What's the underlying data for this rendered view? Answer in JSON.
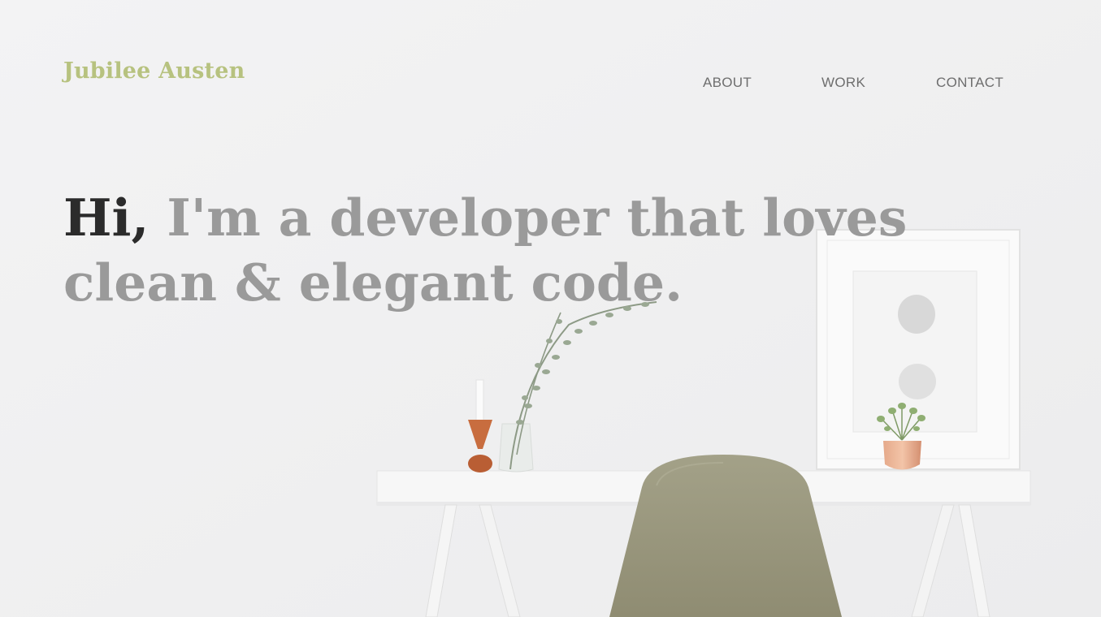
{
  "header": {
    "brand": "Jubilee Austen",
    "nav": {
      "about": "ABOUT",
      "work": "WORK",
      "contact": "CONTACT"
    }
  },
  "hero": {
    "greeting": "Hi,",
    "line1_rest": " I'm a developer that loves",
    "line2": "clean & elegant code."
  },
  "colors": {
    "brand": "#b7c27f",
    "nav_text": "#6e6e6e",
    "headline": "#9a9a9a",
    "greeting": "#2b2b2b",
    "background": "#f0f0f1"
  }
}
